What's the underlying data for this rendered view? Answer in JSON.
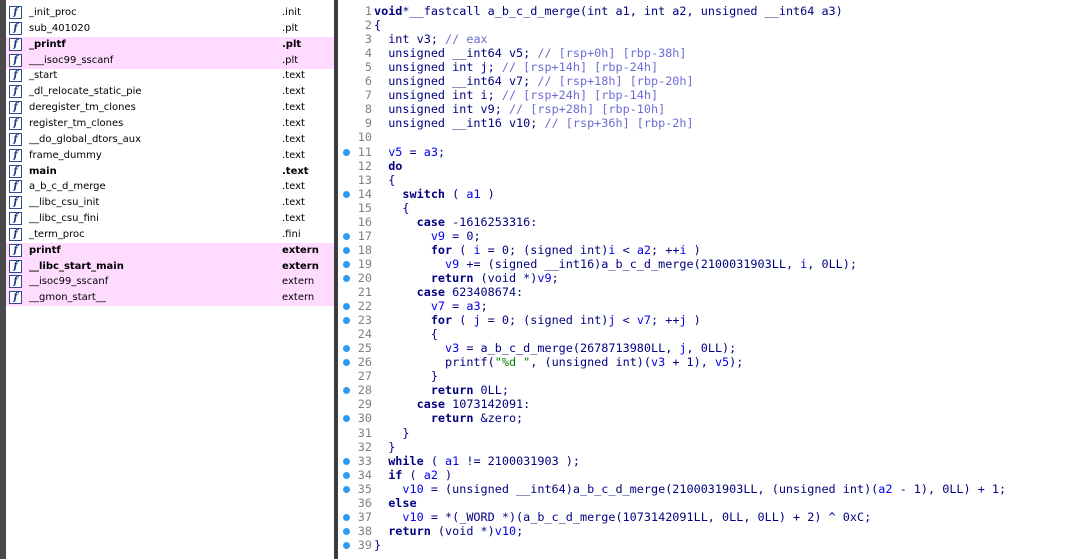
{
  "functions": [
    {
      "name": "_init_proc",
      "segment": ".init",
      "highlight": false,
      "bold": false
    },
    {
      "name": "sub_401020",
      "segment": ".plt",
      "highlight": false,
      "bold": false
    },
    {
      "name": "_printf",
      "segment": ".plt",
      "highlight": true,
      "bold": true
    },
    {
      "name": "___isoc99_sscanf",
      "segment": ".plt",
      "highlight": true,
      "bold": false
    },
    {
      "name": "_start",
      "segment": ".text",
      "highlight": false,
      "bold": false
    },
    {
      "name": "_dl_relocate_static_pie",
      "segment": ".text",
      "highlight": false,
      "bold": false
    },
    {
      "name": "deregister_tm_clones",
      "segment": ".text",
      "highlight": false,
      "bold": false
    },
    {
      "name": "register_tm_clones",
      "segment": ".text",
      "highlight": false,
      "bold": false
    },
    {
      "name": "__do_global_dtors_aux",
      "segment": ".text",
      "highlight": false,
      "bold": false
    },
    {
      "name": "frame_dummy",
      "segment": ".text",
      "highlight": false,
      "bold": false
    },
    {
      "name": "main",
      "segment": ".text",
      "highlight": false,
      "bold": true
    },
    {
      "name": "a_b_c_d_merge",
      "segment": ".text",
      "highlight": false,
      "bold": false
    },
    {
      "name": "__libc_csu_init",
      "segment": ".text",
      "highlight": false,
      "bold": false
    },
    {
      "name": "__libc_csu_fini",
      "segment": ".text",
      "highlight": false,
      "bold": false
    },
    {
      "name": "_term_proc",
      "segment": ".fini",
      "highlight": false,
      "bold": false
    },
    {
      "name": "printf",
      "segment": "extern",
      "highlight": true,
      "bold": true
    },
    {
      "name": "__libc_start_main",
      "segment": "extern",
      "highlight": true,
      "bold": true
    },
    {
      "name": "__isoc99_sscanf",
      "segment": "extern",
      "highlight": true,
      "bold": false
    },
    {
      "name": "__gmon_start__",
      "segment": "extern",
      "highlight": true,
      "bold": false
    }
  ],
  "code": [
    {
      "n": "1",
      "dot": false,
      "t": [
        [
          "kw",
          "void"
        ],
        [
          "",
          "*__fastcall a_b_c_d_merge(int a1, int a2, unsigned __int64 a3)"
        ]
      ]
    },
    {
      "n": "2",
      "dot": false,
      "t": [
        [
          "",
          "{"
        ]
      ]
    },
    {
      "n": "3",
      "dot": false,
      "t": [
        [
          "",
          "  int v3; "
        ],
        [
          "cm",
          "// eax"
        ]
      ]
    },
    {
      "n": "4",
      "dot": false,
      "t": [
        [
          "",
          "  unsigned __int64 v5; "
        ],
        [
          "cm",
          "// [rsp+0h] [rbp-38h]"
        ]
      ]
    },
    {
      "n": "5",
      "dot": false,
      "t": [
        [
          "",
          "  unsigned int j; "
        ],
        [
          "cm",
          "// [rsp+14h] [rbp-24h]"
        ]
      ]
    },
    {
      "n": "6",
      "dot": false,
      "t": [
        [
          "",
          "  unsigned __int64 v7; "
        ],
        [
          "cm",
          "// [rsp+18h] [rbp-20h]"
        ]
      ]
    },
    {
      "n": "7",
      "dot": false,
      "t": [
        [
          "",
          "  unsigned int i; "
        ],
        [
          "cm",
          "// [rsp+24h] [rbp-14h]"
        ]
      ]
    },
    {
      "n": "8",
      "dot": false,
      "t": [
        [
          "",
          "  unsigned int v9; "
        ],
        [
          "cm",
          "// [rsp+28h] [rbp-10h]"
        ]
      ]
    },
    {
      "n": "9",
      "dot": false,
      "t": [
        [
          "",
          "  unsigned __int16 v10; "
        ],
        [
          "cm",
          "// [rsp+36h] [rbp-2h]"
        ]
      ]
    },
    {
      "n": "10",
      "dot": false,
      "t": [
        [
          "",
          ""
        ]
      ]
    },
    {
      "n": "11",
      "dot": true,
      "t": [
        [
          "var",
          "  v5"
        ],
        [
          "",
          " = "
        ],
        [
          "var",
          "a3"
        ],
        [
          "",
          ";"
        ]
      ]
    },
    {
      "n": "12",
      "dot": false,
      "t": [
        [
          "kw",
          "  do"
        ]
      ]
    },
    {
      "n": "13",
      "dot": false,
      "t": [
        [
          "",
          "  {"
        ]
      ]
    },
    {
      "n": "14",
      "dot": true,
      "t": [
        [
          "kw",
          "    switch"
        ],
        [
          "",
          " ( "
        ],
        [
          "var",
          "a1"
        ],
        [
          "",
          " )"
        ]
      ]
    },
    {
      "n": "15",
      "dot": false,
      "t": [
        [
          "",
          "    {"
        ]
      ]
    },
    {
      "n": "16",
      "dot": false,
      "t": [
        [
          "kw",
          "      case"
        ],
        [
          "",
          " -1616253316:"
        ]
      ]
    },
    {
      "n": "17",
      "dot": true,
      "t": [
        [
          "var",
          "        v9"
        ],
        [
          "",
          " = 0;"
        ]
      ]
    },
    {
      "n": "18",
      "dot": true,
      "t": [
        [
          "kw",
          "        for"
        ],
        [
          "",
          " ( "
        ],
        [
          "var",
          "i"
        ],
        [
          "",
          " = 0; (signed int)"
        ],
        [
          "var",
          "i"
        ],
        [
          "",
          " < "
        ],
        [
          "var",
          "a2"
        ],
        [
          "",
          "; ++"
        ],
        [
          "var",
          "i"
        ],
        [
          "",
          " )"
        ]
      ]
    },
    {
      "n": "19",
      "dot": true,
      "t": [
        [
          "var",
          "          v9"
        ],
        [
          "",
          " += (signed __int16)a_b_c_d_merge(2100031903LL, "
        ],
        [
          "var",
          "i"
        ],
        [
          "",
          ", 0LL);"
        ]
      ]
    },
    {
      "n": "20",
      "dot": true,
      "t": [
        [
          "kw",
          "        return"
        ],
        [
          "",
          " (void *)"
        ],
        [
          "var",
          "v9"
        ],
        [
          "",
          ";"
        ]
      ]
    },
    {
      "n": "21",
      "dot": false,
      "t": [
        [
          "kw",
          "      case"
        ],
        [
          "",
          " 623408674:"
        ]
      ]
    },
    {
      "n": "22",
      "dot": true,
      "t": [
        [
          "var",
          "        v7"
        ],
        [
          "",
          " = "
        ],
        [
          "var",
          "a3"
        ],
        [
          "",
          ";"
        ]
      ]
    },
    {
      "n": "23",
      "dot": true,
      "t": [
        [
          "kw",
          "        for"
        ],
        [
          "",
          " ( "
        ],
        [
          "var",
          "j"
        ],
        [
          "",
          " = 0; (signed int)"
        ],
        [
          "var",
          "j"
        ],
        [
          "",
          " < "
        ],
        [
          "var",
          "v7"
        ],
        [
          "",
          "; ++"
        ],
        [
          "var",
          "j"
        ],
        [
          "",
          " )"
        ]
      ]
    },
    {
      "n": "24",
      "dot": false,
      "t": [
        [
          "",
          "        {"
        ]
      ]
    },
    {
      "n": "25",
      "dot": true,
      "t": [
        [
          "var",
          "          v3"
        ],
        [
          "",
          " = a_b_c_d_merge(2678713980LL, "
        ],
        [
          "var",
          "j"
        ],
        [
          "",
          ", 0LL);"
        ]
      ]
    },
    {
      "n": "26",
      "dot": true,
      "t": [
        [
          "",
          "          printf("
        ],
        [
          "str",
          "\"%d \""
        ],
        [
          "",
          ", (unsigned int)("
        ],
        [
          "var",
          "v3"
        ],
        [
          "",
          " + 1), "
        ],
        [
          "var",
          "v5"
        ],
        [
          "",
          ");"
        ]
      ]
    },
    {
      "n": "27",
      "dot": false,
      "t": [
        [
          "",
          "        }"
        ]
      ]
    },
    {
      "n": "28",
      "dot": true,
      "t": [
        [
          "kw",
          "        return"
        ],
        [
          "",
          " 0LL;"
        ]
      ]
    },
    {
      "n": "29",
      "dot": false,
      "t": [
        [
          "kw",
          "      case"
        ],
        [
          "",
          " 1073142091:"
        ]
      ]
    },
    {
      "n": "30",
      "dot": true,
      "t": [
        [
          "kw",
          "        return"
        ],
        [
          "",
          " &zero;"
        ]
      ]
    },
    {
      "n": "31",
      "dot": false,
      "t": [
        [
          "",
          "    }"
        ]
      ]
    },
    {
      "n": "32",
      "dot": false,
      "t": [
        [
          "",
          "  }"
        ]
      ]
    },
    {
      "n": "33",
      "dot": true,
      "t": [
        [
          "kw",
          "  while"
        ],
        [
          "",
          " ( "
        ],
        [
          "var",
          "a1"
        ],
        [
          "",
          " != 2100031903 );"
        ]
      ]
    },
    {
      "n": "34",
      "dot": true,
      "t": [
        [
          "kw",
          "  if"
        ],
        [
          "",
          " ( "
        ],
        [
          "var",
          "a2"
        ],
        [
          "",
          " )"
        ]
      ]
    },
    {
      "n": "35",
      "dot": true,
      "t": [
        [
          "var",
          "    v10"
        ],
        [
          "",
          " = (unsigned __int64)a_b_c_d_merge(2100031903LL, (unsigned int)("
        ],
        [
          "var",
          "a2"
        ],
        [
          "",
          " - 1), 0LL) + 1;"
        ]
      ]
    },
    {
      "n": "36",
      "dot": false,
      "t": [
        [
          "kw",
          "  else"
        ]
      ]
    },
    {
      "n": "37",
      "dot": true,
      "t": [
        [
          "var",
          "    v10"
        ],
        [
          "",
          " = *(_WORD *)(a_b_c_d_merge(1073142091LL, 0LL, 0LL) + 2) ^ 0xC;"
        ]
      ]
    },
    {
      "n": "38",
      "dot": true,
      "t": [
        [
          "kw",
          "  return"
        ],
        [
          "",
          " (void *)"
        ],
        [
          "var",
          "v10"
        ],
        [
          "",
          ";"
        ]
      ]
    },
    {
      "n": "39",
      "dot": true,
      "t": [
        [
          "",
          "}"
        ]
      ]
    }
  ]
}
